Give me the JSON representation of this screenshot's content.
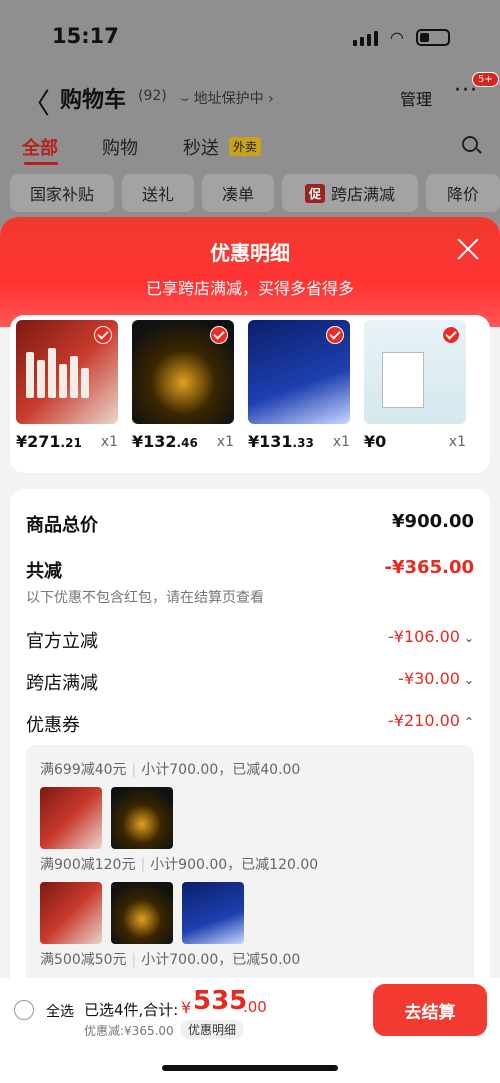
{
  "status_bar": {
    "time": "15:17"
  },
  "nav": {
    "back": "〈",
    "title": "购物车",
    "count": "(92)",
    "address_protect": "⌣ 地址保护中 ›",
    "manage": "管理",
    "more": "···",
    "badge": "5+"
  },
  "tabs": [
    {
      "label": "全部"
    },
    {
      "label": "购物"
    },
    {
      "label": "秒送"
    }
  ],
  "flash_badge": "外卖",
  "filters": [
    {
      "label": "国家补贴"
    },
    {
      "label": "送礼"
    },
    {
      "label": "凑单"
    },
    {
      "label": "跨店满减",
      "promo": "促"
    },
    {
      "label": "降价"
    }
  ],
  "sheet": {
    "title": "优惠明细",
    "subtitle": "已享跨店满减，买得多省得多",
    "products": [
      {
        "price_int": "¥271",
        "price_dec": ".21",
        "qty": "x1",
        "image": "red-skincare-set"
      },
      {
        "price_int": "¥132",
        "price_dec": ".46",
        "qty": "x1",
        "image": "golden-serum"
      },
      {
        "price_int": "¥131",
        "price_dec": ".33",
        "qty": "x1",
        "image": "blue-firming-cream"
      },
      {
        "price_int": "¥0",
        "price_dec": "",
        "qty": "x1",
        "image": "trial-sample-pack"
      }
    ],
    "summary": {
      "total_label": "商品总价",
      "total_value": "¥900.00",
      "reduction_label": "共减",
      "reduction_value": "-¥365.00",
      "reduction_note": "以下优惠不包含红包，请在结算页查看",
      "official_label": "官方立减",
      "official_value": "-¥106.00",
      "cross_store_label": "跨店满减",
      "cross_store_value": "-¥30.00",
      "coupon_label": "优惠券",
      "coupon_value": "-¥210.00"
    },
    "coupons": [
      {
        "rule": "满699减40元",
        "detail": "小计700.00，已减40.00"
      },
      {
        "rule": "满900减120元",
        "detail": "小计900.00，已减120.00"
      },
      {
        "rule": "满500减50元",
        "detail": "小计700.00，已减50.00"
      }
    ]
  },
  "checkout": {
    "select_all": "全选",
    "selected": "已选4件,合计:",
    "currency": "¥",
    "total_int": "535",
    "total_dec": ".00",
    "discount_note": "优惠减:¥365.00",
    "discount_detail": "优惠明细",
    "button": "去结算"
  },
  "colors": {
    "accent": "#f23a30",
    "discount_red": "#e62a20",
    "tab_active": "#b8201c"
  }
}
